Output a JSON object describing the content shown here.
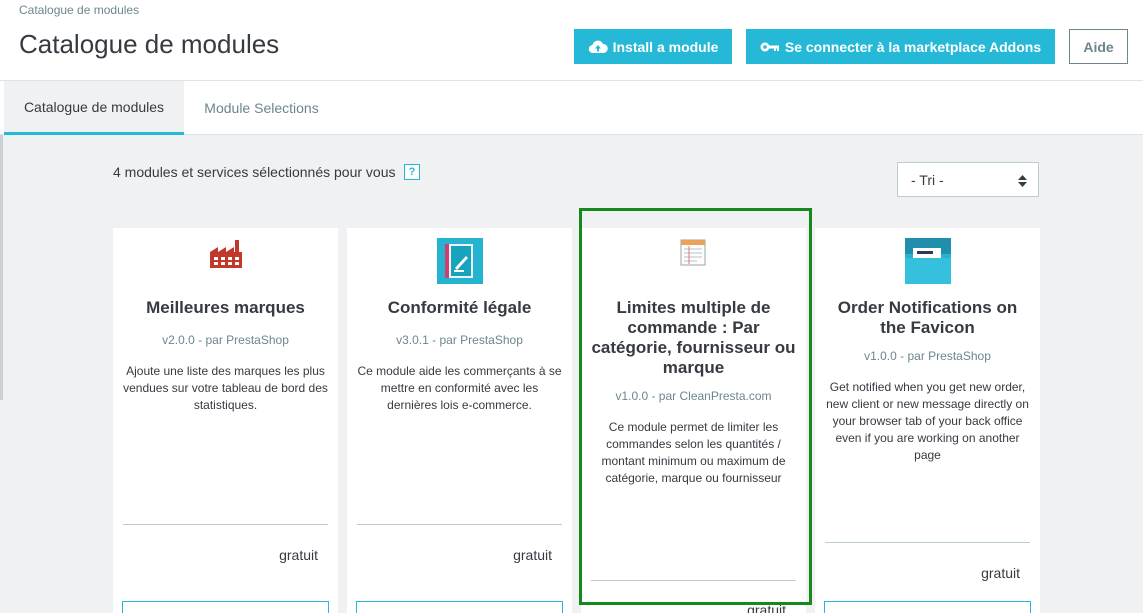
{
  "header": {
    "breadcrumb": "Catalogue de modules",
    "title": "Catalogue de modules",
    "install_button": "Install a module",
    "connect_button": "Se connecter à la marketplace Addons",
    "help_button": "Aide"
  },
  "tabs": [
    {
      "label": "Catalogue de modules",
      "active": true
    },
    {
      "label": "Module Selections",
      "active": false
    }
  ],
  "toolbar": {
    "count_text": "4 modules et services sélectionnés pour vous",
    "help_badge": "?",
    "sort_value": "- Tri -"
  },
  "modules": [
    {
      "icon": "factory-icon",
      "title": "Meilleures marques",
      "version": "v2.0.0 - par PrestaShop",
      "description": "Ajoute une liste des marques les plus vendues sur votre tableau de bord des statistiques.",
      "price": "gratuit"
    },
    {
      "icon": "legal-book-icon",
      "title": "Conformité légale",
      "version": "v3.0.1 - par PrestaShop",
      "description": "Ce module aide les commerçants à se mettre en conformité avec les dernières lois e-commerce.",
      "price": "gratuit"
    },
    {
      "icon": "notepad-icon",
      "title": "Limites multiple de commande : Par catégorie, fournisseur ou marque",
      "version": "v1.0.0 - par CleanPresta.com",
      "description": "Ce module permet de limiter les commandes selon les quantités / montant minimum ou maximum de catégorie, marque ou fournisseur",
      "price": "gratuit"
    },
    {
      "icon": "folder-notification-icon",
      "title": "Order Notifications on the Favicon",
      "version": "v1.0.0 - par PrestaShop",
      "description": "Get notified when you get new order, new client or new message directly on your browser tab of your back office even if you are working on another page",
      "price": "gratuit"
    }
  ],
  "colors": {
    "primary": "#25b9d7",
    "highlight": "#15891a",
    "background": "#eff1f2"
  }
}
